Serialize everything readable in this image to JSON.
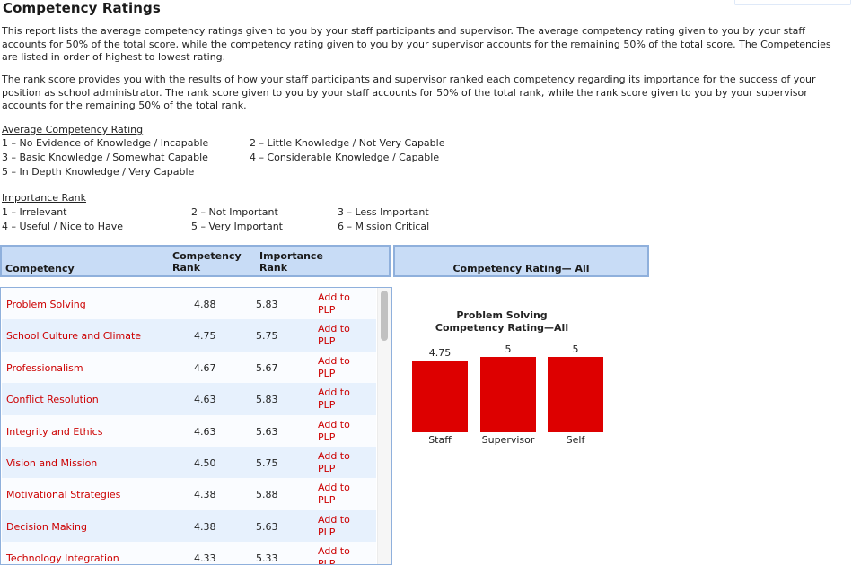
{
  "page": {
    "title": "Competency Ratings",
    "paragraphs": [
      "This report lists the average competency ratings given to you by your staff participants and supervisor. The average competency rating given to you by your staff accounts for 50% of the total score, while the competency rating given to you by your supervisor accounts for the remaining 50% of the total score. The Competencies are listed in order of highest to lowest rating.",
      "The rank score provides you with the results of how your staff participants and supervisor ranked each competency regarding its importance for the success of your position as school administrator. The rank score given to you by your staff accounts for 50% of the total rank, while the rank score given to you by your supervisor accounts for the remaining 50% of the total rank."
    ]
  },
  "legend_rating": {
    "title": "Average Competency Rating",
    "items": [
      "1 – No Evidence of Knowledge / Incapable",
      "2 – Little Knowledge / Not Very Capable",
      "3 – Basic Knowledge / Somewhat Capable",
      "4 – Considerable Knowledge / Capable",
      "5 – In Depth Knowledge / Very Capable"
    ]
  },
  "legend_importance": {
    "title": "Importance Rank",
    "items": [
      "1 – Irrelevant",
      "2 – Not Important",
      "3 – Less Important",
      "4 – Useful / Nice to Have",
      "5 – Very Important",
      "6 – Mission Critical"
    ]
  },
  "table": {
    "headers": {
      "competency": "Competency",
      "competency_rank_line1": "Competency",
      "competency_rank_line2": "Rank",
      "importance_rank_line1": "Importance",
      "importance_rank_line2": "Rank",
      "chart_panel": "Competency Rating— All"
    },
    "add_label_line1": "Add to",
    "add_label_line2": "PLP",
    "rows": [
      {
        "name": "Problem Solving",
        "competency_rank": "4.88",
        "importance_rank": "5.83"
      },
      {
        "name": "School Culture and Climate",
        "competency_rank": "4.75",
        "importance_rank": "5.75"
      },
      {
        "name": "Professionalism",
        "competency_rank": "4.67",
        "importance_rank": "5.67"
      },
      {
        "name": "Conflict Resolution",
        "competency_rank": "4.63",
        "importance_rank": "5.83"
      },
      {
        "name": "Integrity and Ethics",
        "competency_rank": "4.63",
        "importance_rank": "5.63"
      },
      {
        "name": "Vision and Mission",
        "competency_rank": "4.50",
        "importance_rank": "5.75"
      },
      {
        "name": "Motivational Strategies",
        "competency_rank": "4.38",
        "importance_rank": "5.88"
      },
      {
        "name": "Decision Making",
        "competency_rank": "4.38",
        "importance_rank": "5.63"
      },
      {
        "name": "Technology Integration",
        "competency_rank": "4.33",
        "importance_rank": "5.33"
      }
    ]
  },
  "colors": {
    "accent_red": "#cc0000",
    "bar_red": "#dd0000",
    "header_blue": "#c8dcf6",
    "row_alt": "#e7f1fd"
  },
  "chart_data": {
    "type": "bar",
    "title": "Problem Solving",
    "subtitle": "Competency Rating—All",
    "categories": [
      "Staff",
      "Supervisor",
      "Self"
    ],
    "values": [
      4.75,
      5,
      5
    ],
    "value_labels": [
      "4.75",
      "5",
      "5"
    ],
    "ylim": [
      0,
      5
    ],
    "xlabel": "",
    "ylabel": "",
    "grid": false,
    "legend": "none"
  }
}
